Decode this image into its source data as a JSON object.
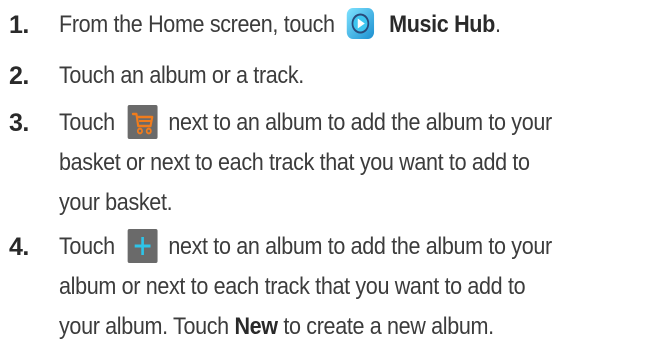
{
  "steps": [
    {
      "number": "1.",
      "lines": [
        {
          "before": "From the Home screen, touch",
          "bold": "Music Hub",
          "after": "."
        }
      ],
      "icon": "music-hub-icon"
    },
    {
      "number": "2.",
      "lines": [
        {
          "text": "Touch an album or a track."
        }
      ]
    },
    {
      "number": "3.",
      "icon": "cart-icon",
      "lines": [
        {
          "before": "Touch",
          "after": "next to an album to add the album to your"
        },
        {
          "text": "basket or next to each track that you want to add to"
        },
        {
          "text": "your basket."
        }
      ]
    },
    {
      "number": "4.",
      "icon": "plus-icon",
      "lines": [
        {
          "before": "Touch",
          "after": "next to an album to add the album to your"
        },
        {
          "text": "album or next to each track that you want to add to"
        },
        {
          "before": "your album. Touch",
          "bold": "New",
          "after": "to create a new album."
        }
      ]
    }
  ],
  "colors": {
    "text": "#3c3c3c",
    "icon_bg": "#6a6a6a",
    "cart_color": "#f07c1c",
    "plus_color": "#2ec4e8"
  }
}
